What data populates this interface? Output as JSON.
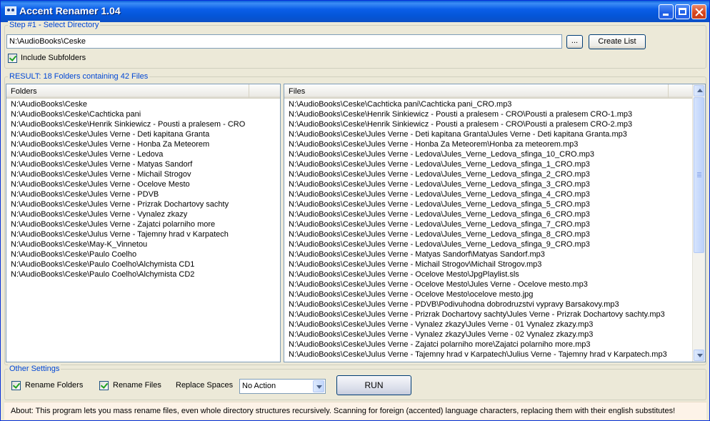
{
  "window": {
    "title": "Accent Renamer 1.04"
  },
  "step1": {
    "title": "Step #1 - Select Directory",
    "directory": "N:\\AudioBooks\\Ceske",
    "browse_label": "...",
    "create_list_label": "Create List",
    "include_subfolders_label": "Include Subfolders",
    "include_subfolders_checked": true
  },
  "result": {
    "title": "RESULT: 18 Folders containing 42 Files",
    "folders_header": "Folders",
    "files_header": "Files",
    "folders": [
      "N:\\AudioBooks\\Ceske",
      "N:\\AudioBooks\\Ceske\\Cachticka pani",
      "N:\\AudioBooks\\Ceske\\Henrik Sinkiewicz - Pousti a pralesem - CRO",
      "N:\\AudioBooks\\Ceske\\Jules Verne - Deti kapitana Granta",
      "N:\\AudioBooks\\Ceske\\Jules Verne - Honba Za Meteorem",
      "N:\\AudioBooks\\Ceske\\Jules Verne - Ledova",
      "N:\\AudioBooks\\Ceske\\Jules Verne - Matyas Sandorf",
      "N:\\AudioBooks\\Ceske\\Jules Verne - Michail Strogov",
      "N:\\AudioBooks\\Ceske\\Jules Verne - Ocelove Mesto",
      "N:\\AudioBooks\\Ceske\\Jules Verne - PDVB",
      "N:\\AudioBooks\\Ceske\\Jules Verne - Prizrak Dochartovy sachty",
      "N:\\AudioBooks\\Ceske\\Jules Verne - Vynalez zkazy",
      "N:\\AudioBooks\\Ceske\\Jules Verne - Zajatci polarniho more",
      "N:\\AudioBooks\\Ceske\\Julus Verne - Tajemny hrad v Karpatech",
      "N:\\AudioBooks\\Ceske\\May-K_Vinnetou",
      "N:\\AudioBooks\\Ceske\\Paulo Coelho",
      "N:\\AudioBooks\\Ceske\\Paulo Coelho\\Alchymista CD1",
      "N:\\AudioBooks\\Ceske\\Paulo Coelho\\Alchymista CD2"
    ],
    "files": [
      "N:\\AudioBooks\\Ceske\\Cachticka pani\\Cachticka pani_CRO.mp3",
      "N:\\AudioBooks\\Ceske\\Henrik Sinkiewicz - Pousti a pralesem - CRO\\Pousti a pralesem CRO-1.mp3",
      "N:\\AudioBooks\\Ceske\\Henrik Sinkiewicz - Pousti a pralesem - CRO\\Pousti a pralesem CRO-2.mp3",
      "N:\\AudioBooks\\Ceske\\Jules Verne - Deti kapitana Granta\\Jules Verne -  Deti kapitana Granta.mp3",
      "N:\\AudioBooks\\Ceske\\Jules Verne - Honba Za Meteorem\\Honba za meteorem.mp3",
      "N:\\AudioBooks\\Ceske\\Jules Verne - Ledova\\Jules_Verne_Ledova_sfinga_10_CRO.mp3",
      "N:\\AudioBooks\\Ceske\\Jules Verne - Ledova\\Jules_Verne_Ledova_sfinga_1_CRO.mp3",
      "N:\\AudioBooks\\Ceske\\Jules Verne - Ledova\\Jules_Verne_Ledova_sfinga_2_CRO.mp3",
      "N:\\AudioBooks\\Ceske\\Jules Verne - Ledova\\Jules_Verne_Ledova_sfinga_3_CRO.mp3",
      "N:\\AudioBooks\\Ceske\\Jules Verne - Ledova\\Jules_Verne_Ledova_sfinga_4_CRO.mp3",
      "N:\\AudioBooks\\Ceske\\Jules Verne - Ledova\\Jules_Verne_Ledova_sfinga_5_CRO.mp3",
      "N:\\AudioBooks\\Ceske\\Jules Verne - Ledova\\Jules_Verne_Ledova_sfinga_6_CRO.mp3",
      "N:\\AudioBooks\\Ceske\\Jules Verne - Ledova\\Jules_Verne_Ledova_sfinga_7_CRO.mp3",
      "N:\\AudioBooks\\Ceske\\Jules Verne - Ledova\\Jules_Verne_Ledova_sfinga_8_CRO.mp3",
      "N:\\AudioBooks\\Ceske\\Jules Verne - Ledova\\Jules_Verne_Ledova_sfinga_9_CRO.mp3",
      "N:\\AudioBooks\\Ceske\\Jules Verne - Matyas Sandorf\\Matyas Sandorf.mp3",
      "N:\\AudioBooks\\Ceske\\Jules Verne - Michail Strogov\\Michail Strogov.mp3",
      "N:\\AudioBooks\\Ceske\\Jules Verne - Ocelove Mesto\\JpgPlaylist.sls",
      "N:\\AudioBooks\\Ceske\\Jules Verne - Ocelove Mesto\\Jules Verne - Ocelove mesto.mp3",
      "N:\\AudioBooks\\Ceske\\Jules Verne - Ocelove Mesto\\ocelove mesto.jpg",
      "N:\\AudioBooks\\Ceske\\Jules Verne - PDVB\\Podivuhodna dobrodruzstvi vypravy Barsakovy.mp3",
      "N:\\AudioBooks\\Ceske\\Jules Verne - Prizrak Dochartovy sachty\\Jules Verne - Prizrak Dochartovy sachty.mp3",
      "N:\\AudioBooks\\Ceske\\Jules Verne - Vynalez zkazy\\Jules Verne - 01 Vynalez zkazy.mp3",
      "N:\\AudioBooks\\Ceske\\Jules Verne - Vynalez zkazy\\Jules Verne - 02 Vynalez zkazy.mp3",
      "N:\\AudioBooks\\Ceske\\Jules Verne - Zajatci polarniho more\\Zajatci polarniho more.mp3",
      "N:\\AudioBooks\\Ceske\\Julus Verne - Tajemny hrad v Karpatech\\Julius Verne - Tajemny hrad v Karpatech.mp3"
    ]
  },
  "other_settings": {
    "title": "Other Settings",
    "rename_folders_label": "Rename Folders",
    "rename_folders_checked": true,
    "rename_files_label": "Rename Files",
    "rename_files_checked": true,
    "replace_spaces_label": "Replace Spaces",
    "replace_spaces_value": "No Action",
    "run_label": "RUN"
  },
  "about": "About: This program lets you mass rename files, even whole directory structures recursively. Scanning for foreign (accented) language characters, replacing them with their english substitutes!",
  "colors": {
    "group_title": "#0046d5",
    "titlebar": "#0a5ee8",
    "about_bg": "#fdf3e8"
  }
}
